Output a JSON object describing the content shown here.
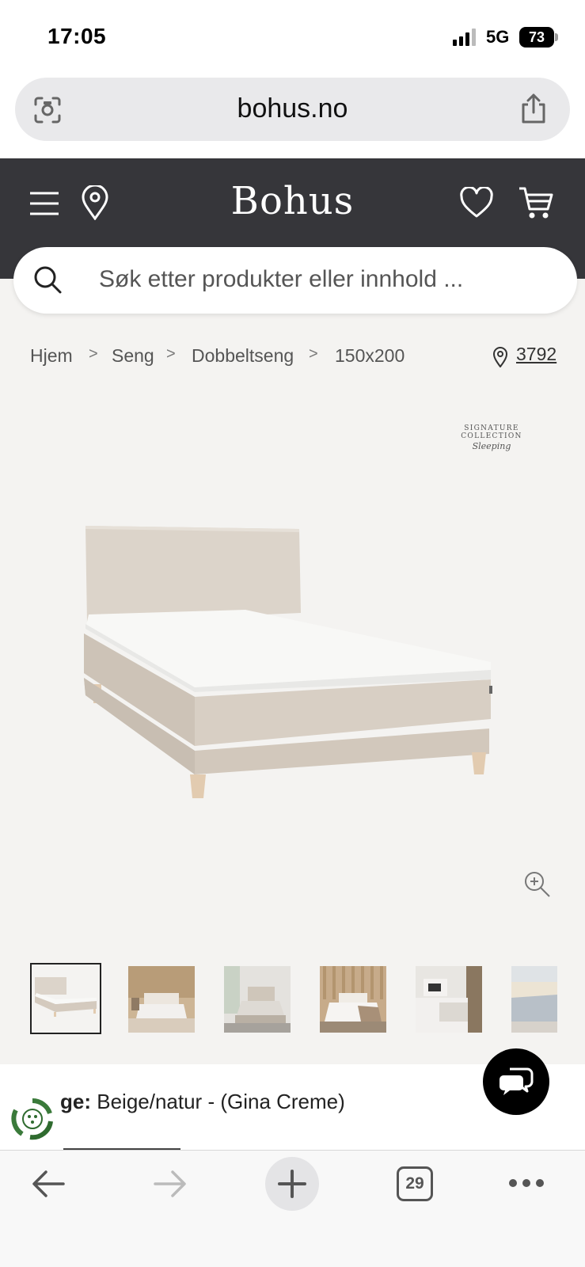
{
  "status_bar": {
    "time": "17:05",
    "network": "5G",
    "battery": "73"
  },
  "browser": {
    "url": "bohus.no",
    "tab_count": "29"
  },
  "site": {
    "logo": "Bohus",
    "search_placeholder": "Søk etter produkter eller innhold ..."
  },
  "breadcrumb": {
    "items": [
      "Hjem",
      "Seng",
      "Dobbeltseng",
      "150x200"
    ],
    "separator": ">"
  },
  "store": {
    "number": "3792"
  },
  "brand_mark": {
    "line1": "SIGNATURE COLLECTION",
    "line2": "Sleeping"
  },
  "product": {
    "color_label": "ge:",
    "color_value": "Beige/natur - (Gina Creme)"
  },
  "colors": {
    "header_bg": "#36363a",
    "content_bg": "#f4f3f1",
    "bed_fabric": "#d9d0c6",
    "mattress": "#f7f7f5",
    "legs": "#e0c9ae"
  },
  "icons": [
    "screen-search-icon",
    "share-icon",
    "menu-icon",
    "location-pin-icon",
    "heart-icon",
    "cart-icon",
    "search-icon",
    "zoom-in-icon",
    "chat-icon",
    "eco-badge-icon",
    "back-icon",
    "forward-icon",
    "plus-icon",
    "more-icon"
  ]
}
